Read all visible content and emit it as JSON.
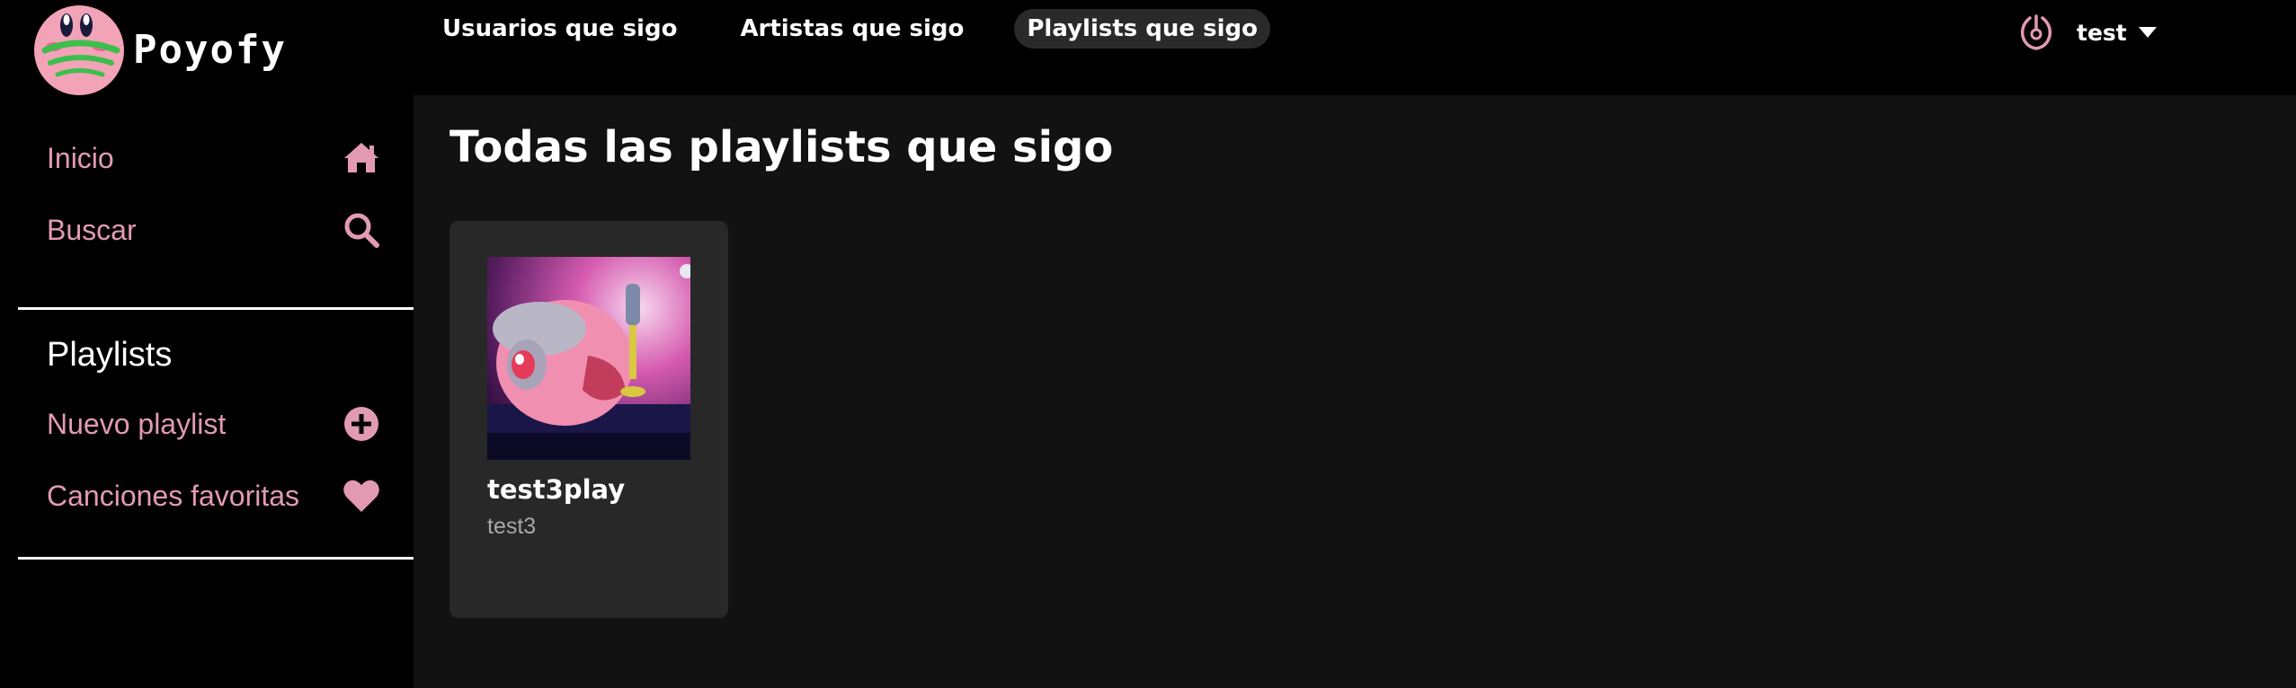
{
  "app": {
    "brand": "Poyofy",
    "logo_icon": "kirby-logo-icon"
  },
  "header": {
    "tabs": [
      {
        "label": "Usuarios que sigo",
        "active": false
      },
      {
        "label": "Artistas que sigo",
        "active": false
      },
      {
        "label": "Playlists que sigo",
        "active": true
      }
    ],
    "user": {
      "name": "test",
      "icon": "user-icon",
      "caret_icon": "caret-down-icon"
    }
  },
  "sidebar": {
    "items": [
      {
        "label": "Inicio",
        "icon": "home-icon"
      },
      {
        "label": "Buscar",
        "icon": "search-icon"
      }
    ],
    "playlists_title": "Playlists",
    "playlist_items": [
      {
        "label": "Nuevo playlist",
        "icon": "plus-circle-icon"
      },
      {
        "label": "Canciones favoritas",
        "icon": "heart-icon"
      }
    ]
  },
  "main": {
    "title": "Todas las playlists que sigo",
    "playlists": [
      {
        "name": "test3play",
        "owner": "test3",
        "cover": "kirby-singing-cover"
      }
    ]
  },
  "colors": {
    "accent_pink": "#e29ab2",
    "background": "#000000",
    "main_background": "#121212",
    "card_background": "#282828",
    "active_tab": "#2a2a2a"
  }
}
